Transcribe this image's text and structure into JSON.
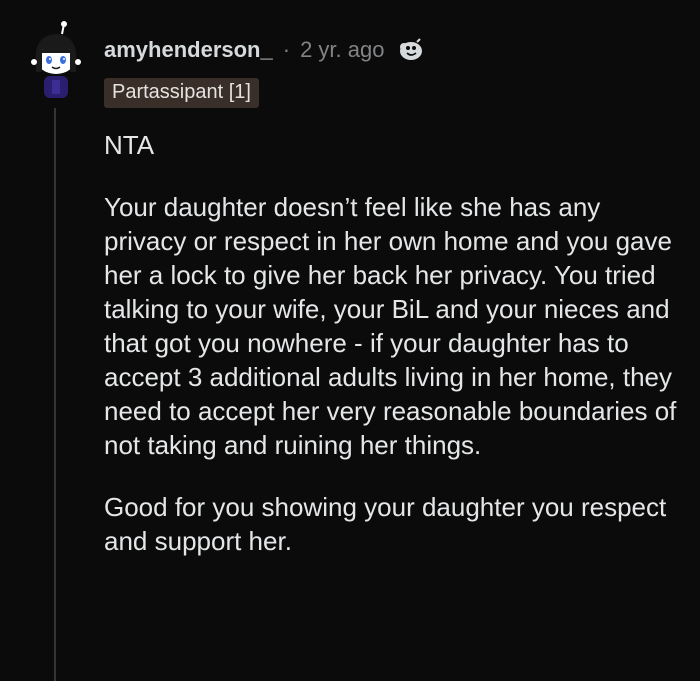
{
  "comment": {
    "username": "amyhenderson_",
    "separator": "·",
    "time_ago": "2 yr. ago",
    "flair": "Partassipant [1]",
    "award_icon": "award-icon",
    "paragraphs": [
      "NTA",
      "Your daughter doesn’t feel like she has any privacy or respect in her own home and you gave her a lock to give her back her privacy. You tried talking to your wife, your BiL and your nieces and that got you nowhere - if your daughter has to accept 3 additional adults living in her home, they need to accept her very reasonable boundaries of not taking and ruining her things.",
      "Good for you showing your daughter you respect and support her."
    ]
  },
  "colors": {
    "background": "#0b0b0b",
    "flair_bg": "#3a2e28",
    "meta_text": "#818384",
    "body_text": "#e4e6e8"
  }
}
